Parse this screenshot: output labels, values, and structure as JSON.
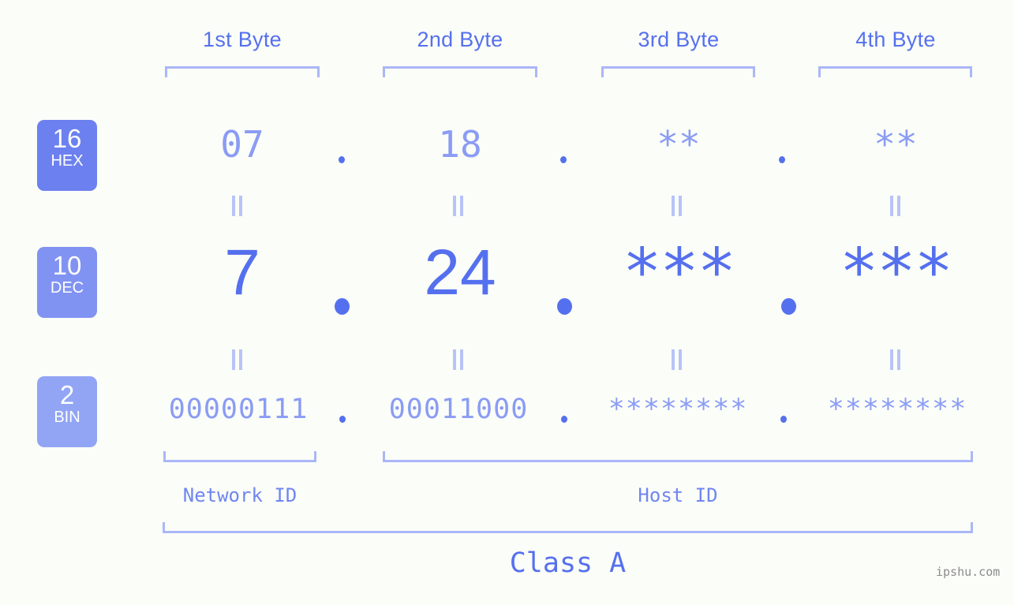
{
  "meta": {
    "background_color": "#fbfdf8",
    "accent_color": "#5570ee",
    "accent_light_color": "#8a9cf4",
    "bracket_color": "#aab7f7",
    "watermark": "ipshu.com"
  },
  "byte_headers": [
    {
      "label": "1st Byte"
    },
    {
      "label": "2nd Byte"
    },
    {
      "label": "3rd Byte"
    },
    {
      "label": "4th Byte"
    }
  ],
  "bases": [
    {
      "number": "16",
      "name": "HEX",
      "color": "#6c81ef"
    },
    {
      "number": "10",
      "name": "DEC",
      "color": "#8193f2"
    },
    {
      "number": "2",
      "name": "BIN",
      "color": "#92a5f5"
    }
  ],
  "rows": {
    "hex": {
      "base": "16",
      "base_name": "HEX",
      "values": [
        "07",
        "18",
        "**",
        "**"
      ],
      "separator": "."
    },
    "dec": {
      "base": "10",
      "base_name": "DEC",
      "values": [
        "7",
        "24",
        "***",
        "***"
      ],
      "separator": "."
    },
    "bin": {
      "base": "2",
      "base_name": "BIN",
      "values": [
        "00000111",
        "00011000",
        "********",
        "********"
      ],
      "separator": "."
    }
  },
  "equality_marks": {
    "glyph": "=",
    "count_per_gap": 4,
    "gaps": 2
  },
  "sections": [
    {
      "label": "Network ID"
    },
    {
      "label": "Host ID"
    }
  ],
  "class": {
    "label": "Class A"
  },
  "chart_data": {
    "type": "table",
    "title": "IPv4 address byte breakdown - Class A",
    "columns": [
      "1st Byte",
      "2nd Byte",
      "3rd Byte",
      "4th Byte"
    ],
    "rows": [
      {
        "base": "16 HEX",
        "values": [
          "07",
          "18",
          "**",
          "**"
        ]
      },
      {
        "base": "10 DEC",
        "values": [
          "7",
          "24",
          "***",
          "***"
        ]
      },
      {
        "base": "2 BIN",
        "values": [
          "00000111",
          "00011000",
          "********",
          "********"
        ]
      }
    ],
    "network_id_bytes": [
      "1st Byte"
    ],
    "host_id_bytes": [
      "2nd Byte",
      "3rd Byte",
      "4th Byte"
    ],
    "address_class": "Class A"
  }
}
